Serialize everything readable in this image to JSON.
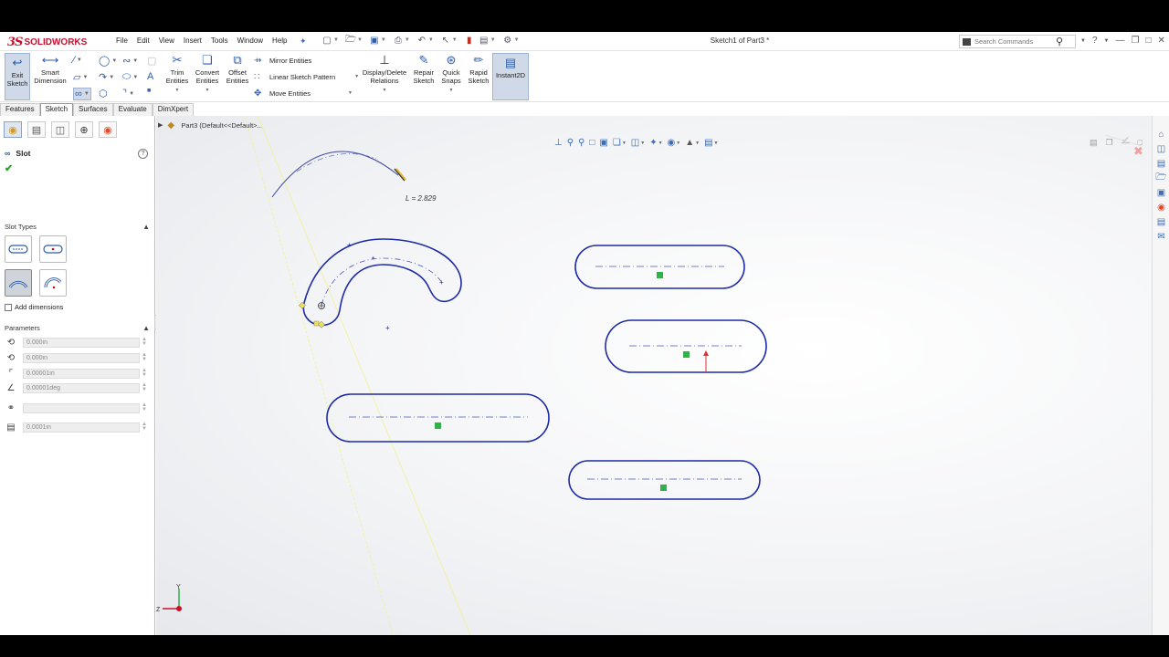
{
  "app": {
    "brand": "SOLIDWORKS",
    "brand_mark": "3S",
    "document_title": "Sketch1 of Part3 *"
  },
  "menu": [
    "File",
    "Edit",
    "View",
    "Insert",
    "Tools",
    "Window",
    "Help"
  ],
  "search": {
    "placeholder": "Search Commands"
  },
  "ribbon": {
    "exit_sketch": "Exit Sketch",
    "smart_dimension": "Smart Dimension",
    "trim_entities": "Trim Entities",
    "convert_entities": "Convert Entities",
    "offset_entities": "Offset Entities",
    "mirror_entities": "Mirror Entities",
    "linear_sketch_pattern": "Linear Sketch Pattern",
    "move_entities": "Move Entities",
    "display_delete_relations": "Display/Delete Relations",
    "repair_sketch": "Repair Sketch",
    "quick_snaps": "Quick Snaps",
    "rapid_sketch": "Rapid Sketch",
    "instant2d": "Instant2D"
  },
  "tabs": [
    "Features",
    "Sketch",
    "Surfaces",
    "Evaluate",
    "DimXpert"
  ],
  "active_tab": "Sketch",
  "property_manager": {
    "title": "Slot",
    "slot_types_header": "Slot Types",
    "add_dimensions_label": "Add dimensions",
    "add_dimensions_checked": false,
    "parameters_header": "Parameters",
    "params": [
      {
        "name": "center-x",
        "value": "0.000in"
      },
      {
        "name": "center-y",
        "value": "0.000in"
      },
      {
        "name": "radius",
        "value": "0.00001in"
      },
      {
        "name": "angle",
        "value": "0.00001deg"
      },
      {
        "name": "blank",
        "value": ""
      },
      {
        "name": "width",
        "value": "0.0001in"
      }
    ]
  },
  "graphics": {
    "breadcrumb": "Part3  (Default<<Default>...",
    "length_readout": "L = 2.829"
  },
  "icons": {
    "search": "search-icon",
    "help": "help-icon",
    "ok": "checkmark-icon",
    "pin": "pin-icon"
  },
  "colors": {
    "sketch_blue": "#1c2aa6",
    "relation_green": "#2db34a",
    "brand_red": "#c8102e",
    "active_button": "#cfd9e8"
  }
}
